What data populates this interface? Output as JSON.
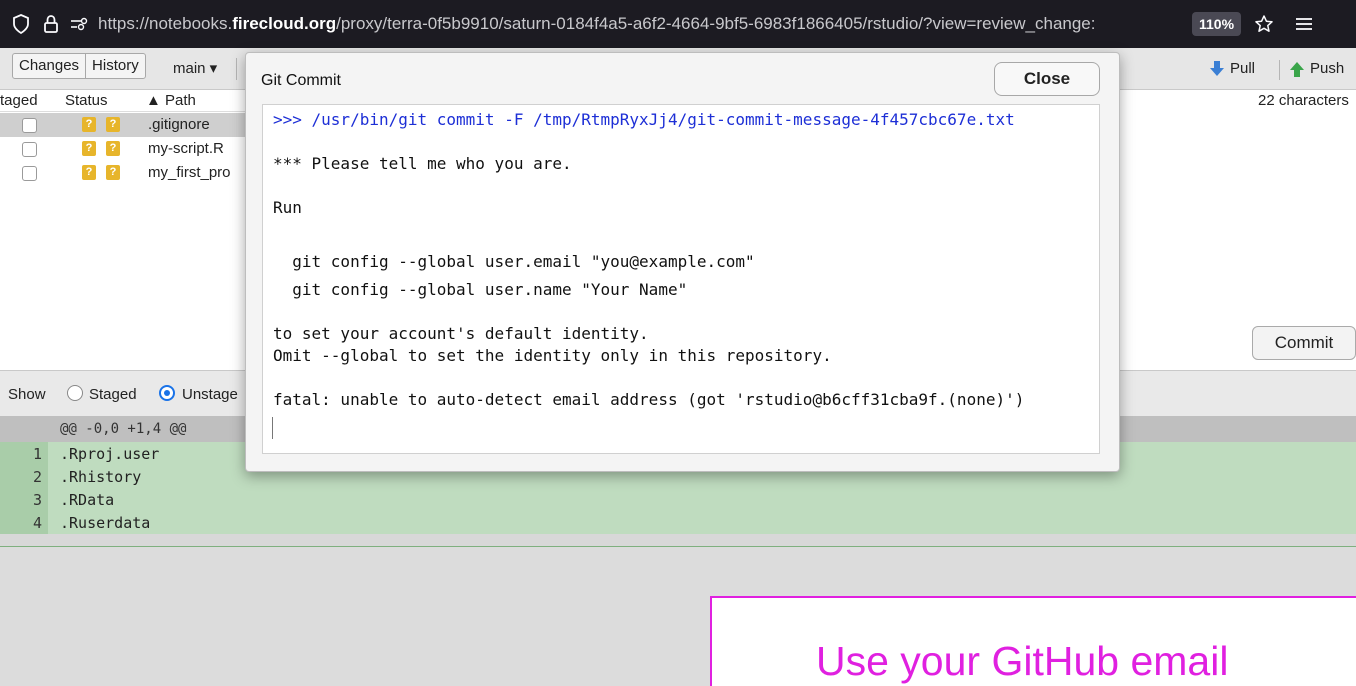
{
  "browser": {
    "url_prefix": "https://notebooks.",
    "url_domain": "firecloud.org",
    "url_rest": "/proxy/terra-0f5b9910/saturn-0184f4a5-a6f2-4664-9bf5-6983f1866405/rstudio/?view=review_change:",
    "zoom": "110%"
  },
  "toolbar": {
    "tabs": [
      "Changes",
      "History"
    ],
    "branch": "main ▾",
    "pull_label": "Pull",
    "push_label": "Push"
  },
  "filelist": {
    "headers": {
      "staged": "taged",
      "status": "Status",
      "path": "▲ Path"
    },
    "char_count": "22 characters",
    "files": [
      {
        "name": ".gitignore",
        "status": [
          "?",
          "?"
        ],
        "selected": true
      },
      {
        "name": "my-script.R",
        "status": [
          "?",
          "?"
        ],
        "selected": false
      },
      {
        "name": "my_first_pro",
        "status": [
          "?",
          "?"
        ],
        "selected": false
      }
    ],
    "commit_label": "Commit"
  },
  "show": {
    "label": "Show",
    "staged": "Staged",
    "unstaged": "Unstage"
  },
  "diff": {
    "hunk": "@@ -0,0 +1,4 @@",
    "lines": [
      {
        "num": "1",
        "text": ".Rproj.user"
      },
      {
        "num": "2",
        "text": ".Rhistory"
      },
      {
        "num": "3",
        "text": ".RData"
      },
      {
        "num": "4",
        "text": ".Ruserdata"
      }
    ]
  },
  "modal": {
    "title": "Git Commit",
    "close_label": "Close",
    "output": [
      ">>> /usr/bin/git commit -F /tmp/RtmpRyxJj4/git-commit-message-4f457cbc67e.txt",
      "*** Please tell me who you are.",
      "Run",
      "  git config --global user.email \"you@example.com\"",
      "  git config --global user.name \"Your Name\"",
      "to set your account's default identity.",
      "Omit --global to set the identity only in this repository.",
      "fatal: unable to auto-detect email address (got 'rstudio@b6cff31cba9f.(none)')"
    ]
  },
  "annotation": {
    "text": "Use your GitHub email"
  },
  "colors": {
    "status_badge": "#e7b52b",
    "annotation": "#e020e0",
    "command_text": "#1d2fd6",
    "diff_added": "#bfdcbf"
  },
  "icons": [
    "shield-icon",
    "lock-icon",
    "permissions-icon",
    "bookmark-star-icon",
    "menu-icon",
    "pull-arrow-icon",
    "push-arrow-icon"
  ]
}
